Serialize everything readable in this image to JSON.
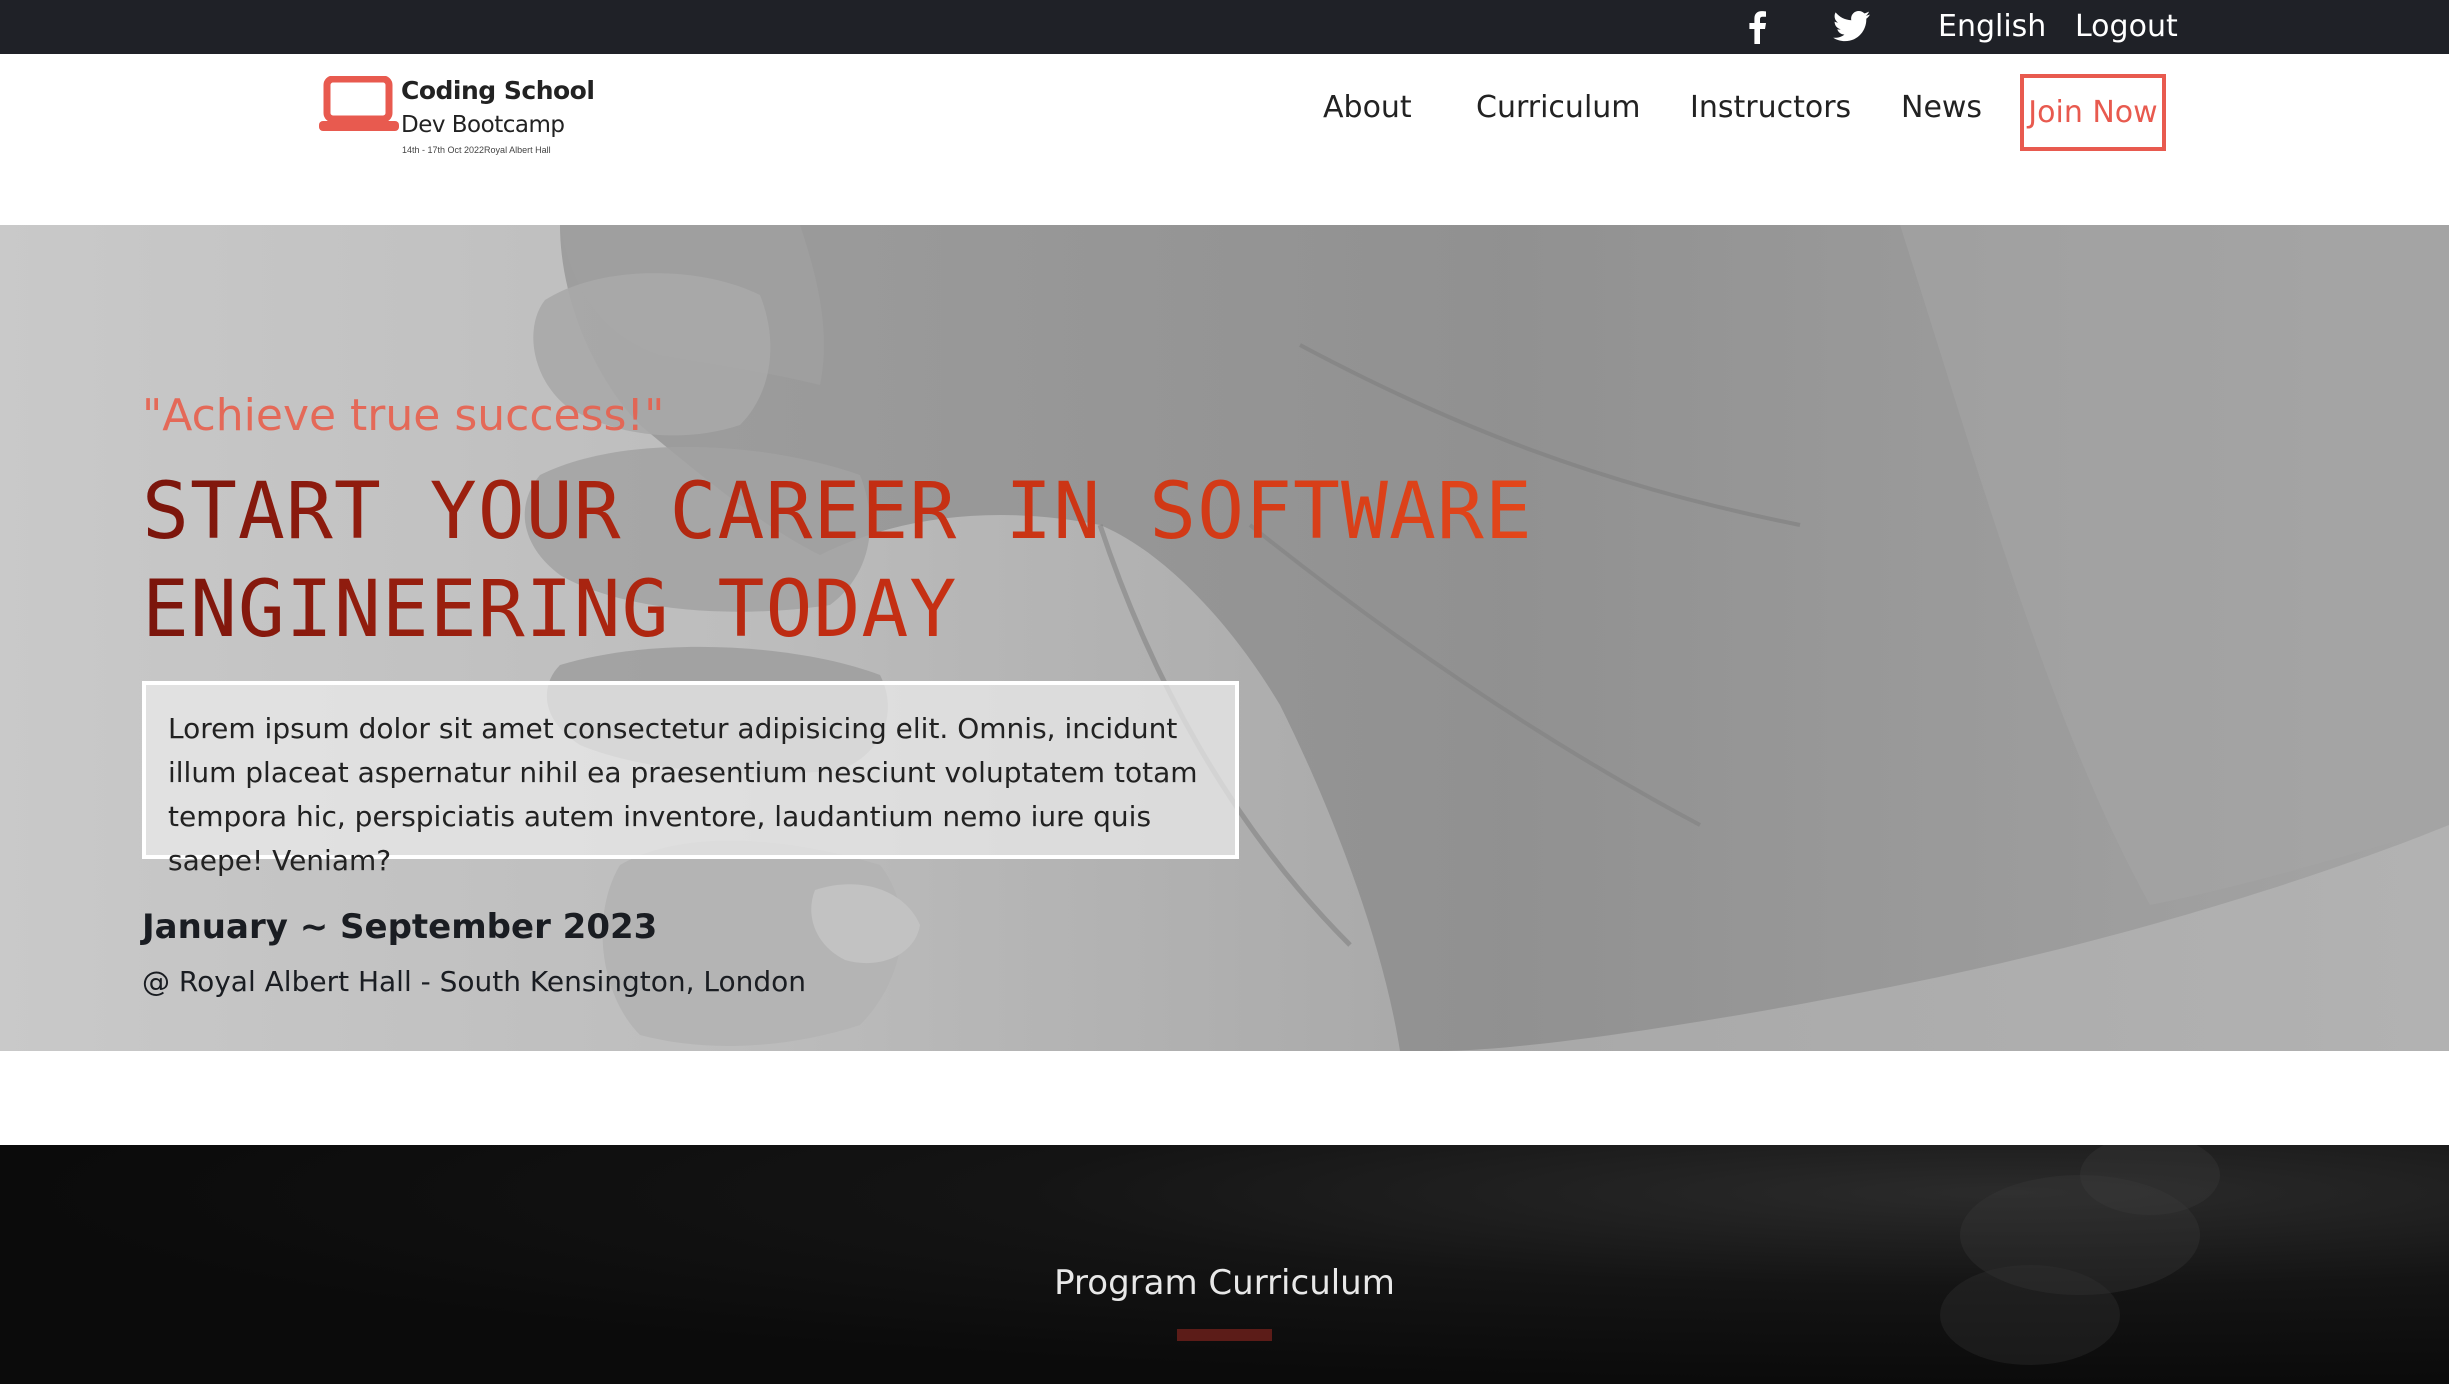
{
  "topbar": {
    "social": [
      {
        "icon": "facebook-icon"
      },
      {
        "icon": "twitter-icon"
      }
    ],
    "language_label": "English",
    "logout_label": "Logout"
  },
  "logo": {
    "line1": "Coding School",
    "line2": "Dev Bootcamp",
    "line3": "14th - 17th Oct 2022Royal Albert Hall",
    "accent_color": "#e85a4f"
  },
  "nav": {
    "items": [
      {
        "label": "About"
      },
      {
        "label": "Curriculum"
      },
      {
        "label": "Instructors"
      },
      {
        "label": "News"
      }
    ],
    "cta_label": "Join Now"
  },
  "hero": {
    "tagline": "\"Achieve true success!\"",
    "title_line1": "START YOUR CAREER IN SOFTWARE",
    "title_line2": "ENGINEERING TODAY",
    "description": "Lorem ipsum dolor sit amet consectetur adipisicing elit. Omnis, incidunt illum placeat aspernatur nihil ea praesentium nesciunt voluptatem totam tempora hic, perspiciatis autem inventore, laudantium nemo iure quis saepe! Veniam?",
    "dates": "January ~ September 2023",
    "venue": "@ Royal Albert Hall - South Kensington, London"
  },
  "curriculum": {
    "title": "Program Curriculum"
  },
  "colors": {
    "topbar_bg": "#1f2127",
    "accent": "#e85a4f",
    "title_dark": "#7a150c",
    "title_bright": "#e84a1c"
  }
}
